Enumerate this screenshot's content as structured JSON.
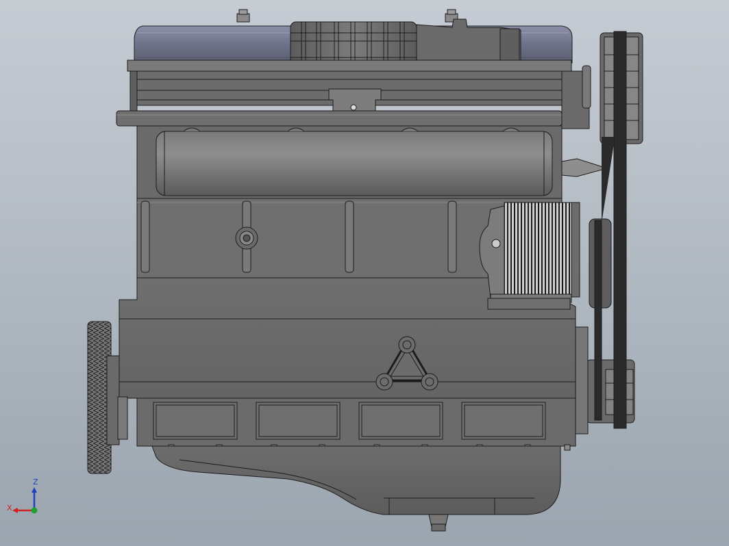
{
  "viewport": {
    "background_top": "#c4cad1",
    "background_bottom": "#9fa8b2",
    "metal_color": "#6d6d6d",
    "metal_dark": "#4a4a4a",
    "metal_light": "#8a8a8a",
    "blue_tint": "#7a7d92",
    "line_color": "#1c1c1c"
  },
  "triad": {
    "x_label": "X",
    "z_label": "Z",
    "x_color": "#d02020",
    "z_color": "#1f3fbf",
    "y_color": "#1fa02f"
  }
}
